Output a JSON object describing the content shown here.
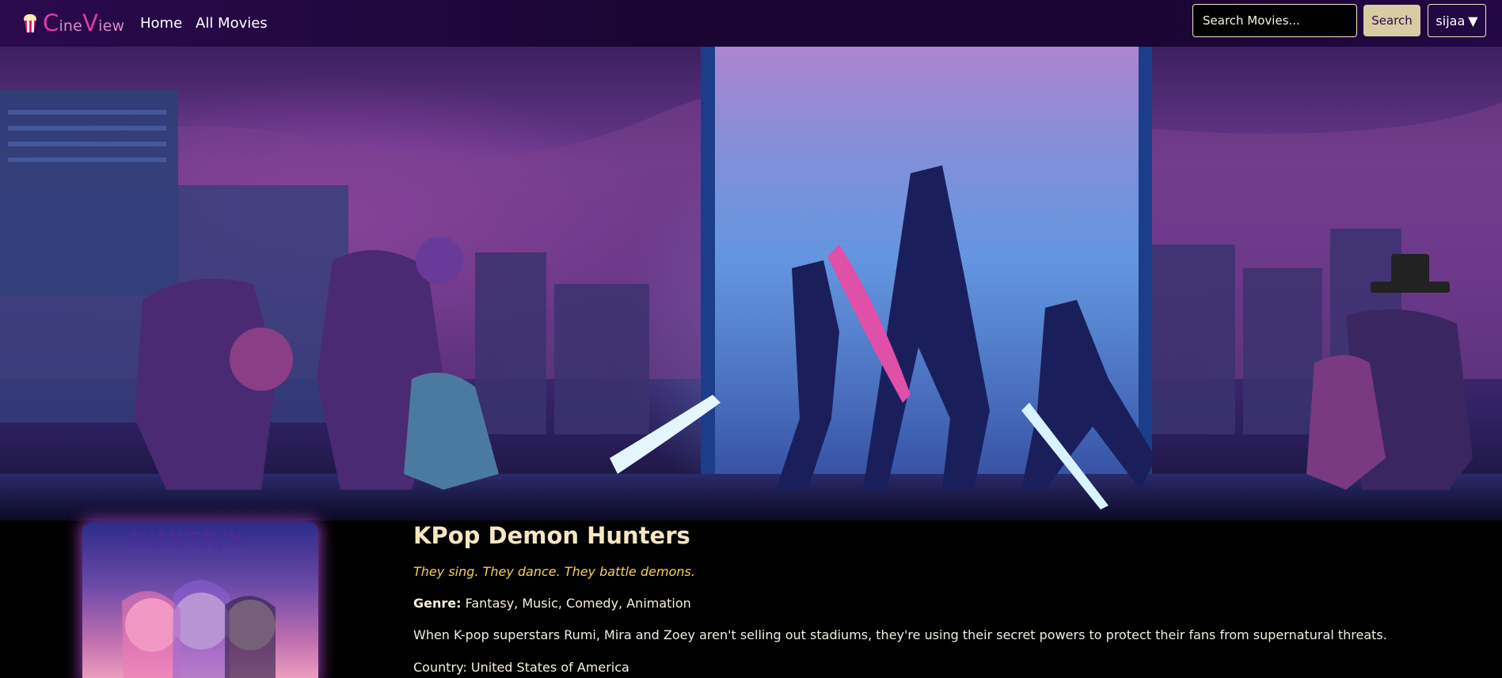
{
  "nav": {
    "brand_first_letter": "C",
    "brand_part1": "ine",
    "brand_second_letter": "V",
    "brand_part2": "iew",
    "links": [
      "Home",
      "All Movies"
    ],
    "search_placeholder": "Search Movies...",
    "search_button": "Search",
    "user_name": "sijaa",
    "user_caret": "▼",
    "popcorn_icon": "popcorn-icon"
  },
  "movie": {
    "title": "KPop Demon Hunters",
    "tagline": "They sing. They dance. They battle demons.",
    "genre_label": "Genre:",
    "genres": "Fantasy, Music, Comedy, Animation",
    "overview": "When K-pop superstars Rumi, Mira and Zoey aren't selling out stadiums, they're using their secret powers to protect their fans from supernatural threats.",
    "country_label": "Country:",
    "country": "United States of America",
    "poster_text": "HUNTR/X"
  },
  "colors": {
    "nav_bg": "#1a0533",
    "brand_accent": "#e23ba5",
    "search_button_bg": "#d9cba3",
    "title": "#f6e7c1",
    "tagline": "#f2cf5b"
  }
}
